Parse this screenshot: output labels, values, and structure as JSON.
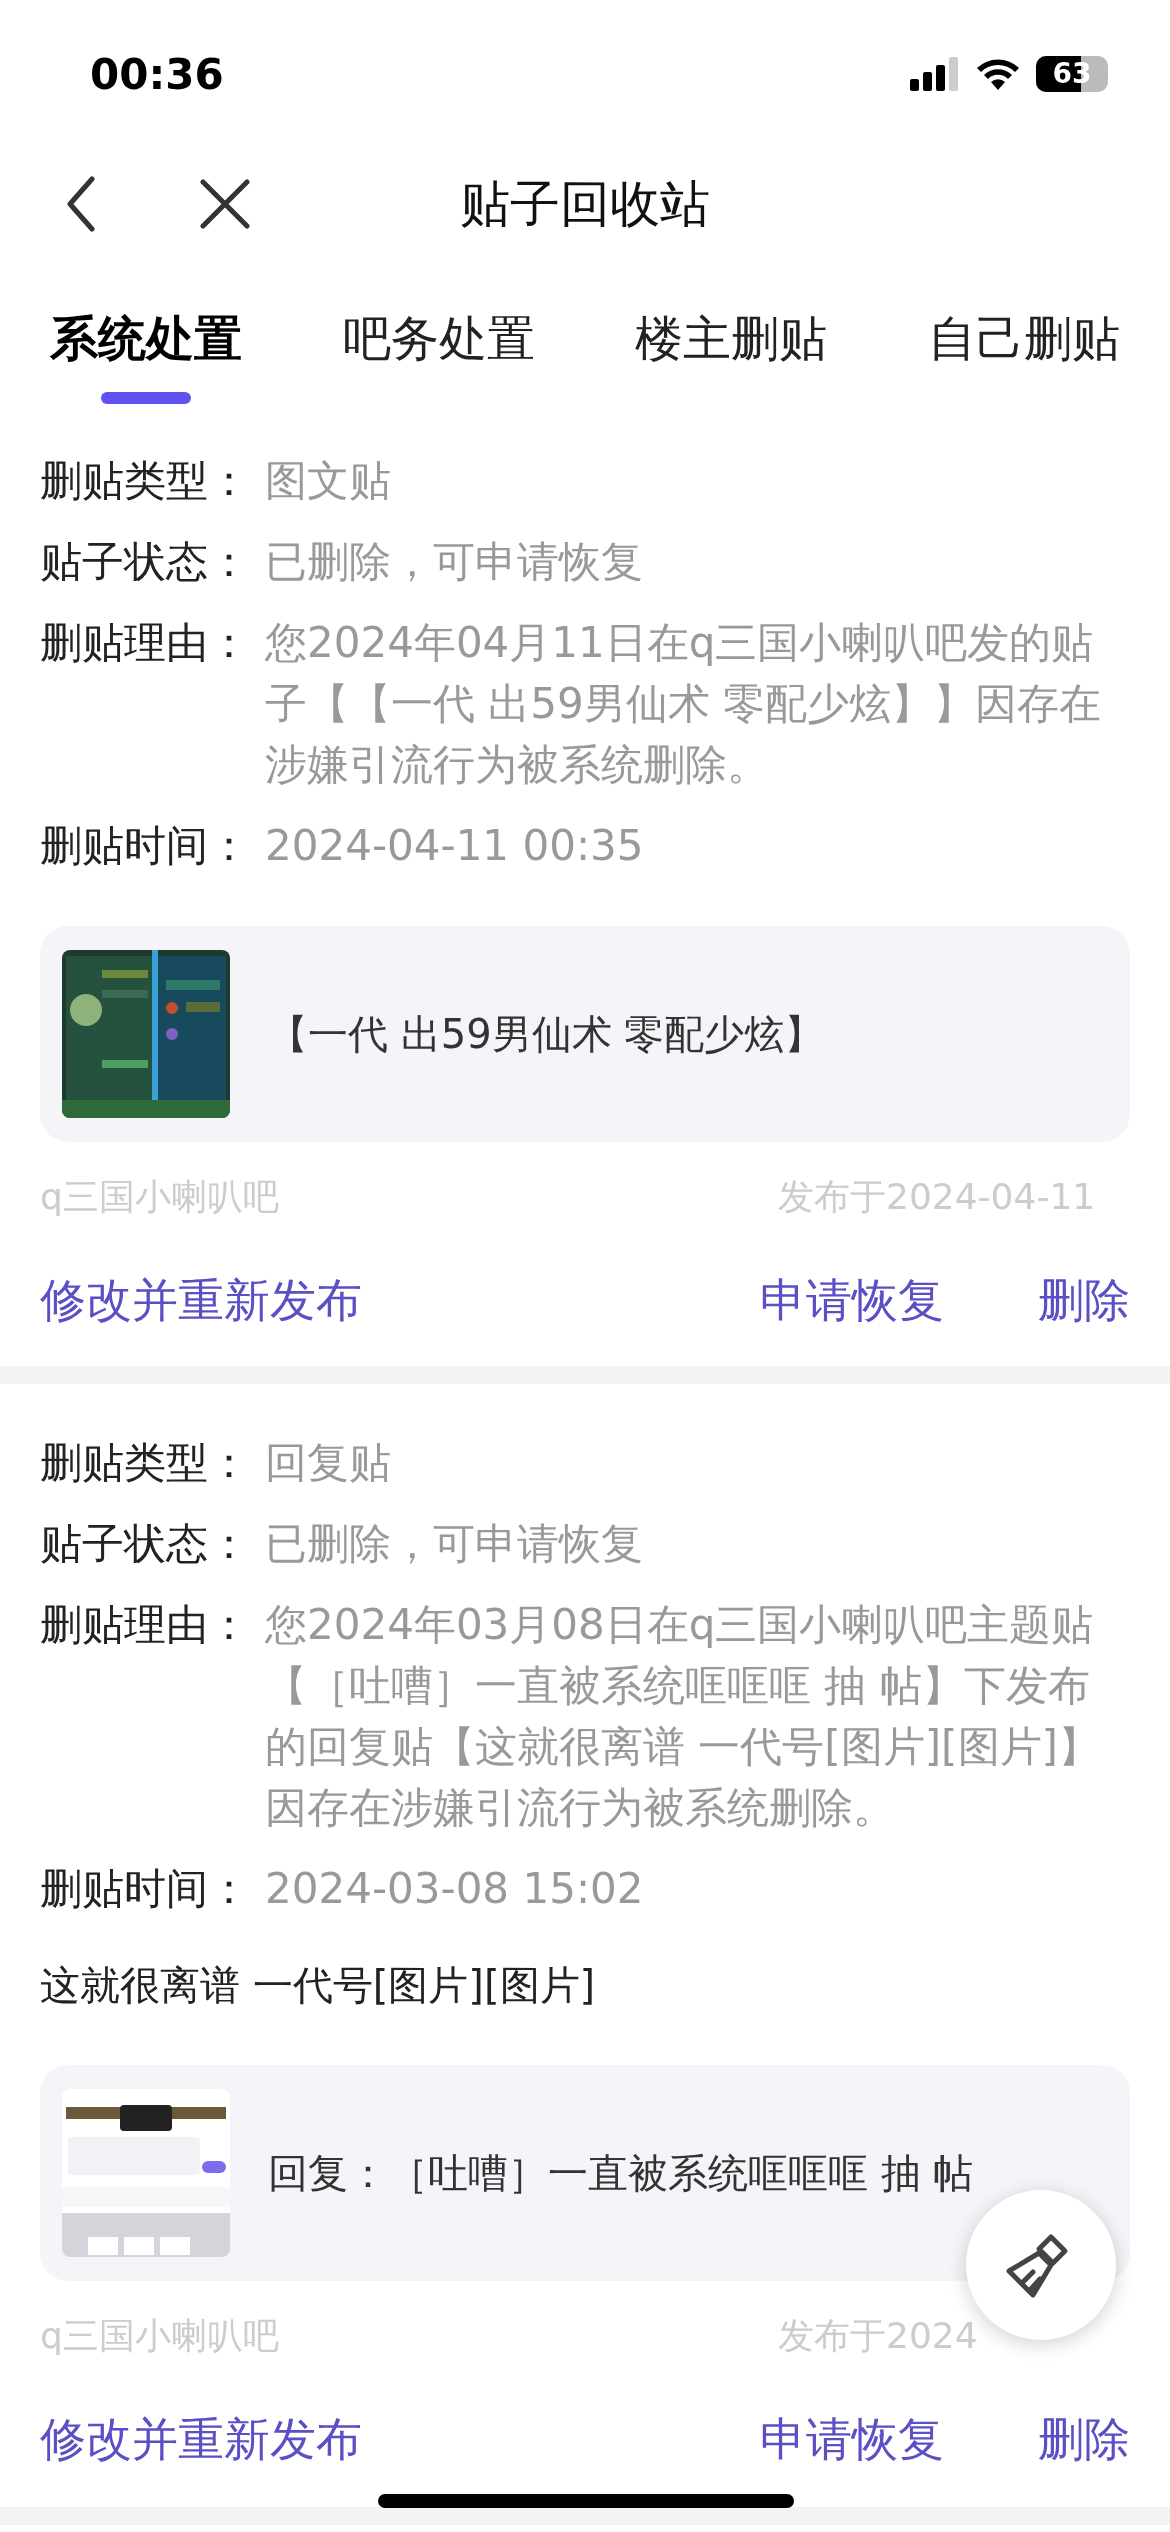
{
  "status_bar": {
    "time": "00:36",
    "battery": "63"
  },
  "nav": {
    "title": "贴子回收站"
  },
  "tabs": [
    {
      "label": "系统处置",
      "selected": true
    },
    {
      "label": "吧务处置",
      "selected": false
    },
    {
      "label": "楼主删贴",
      "selected": false
    },
    {
      "label": "自己删贴",
      "selected": false
    }
  ],
  "posts": [
    {
      "fields": [
        {
          "label": "删贴类型：",
          "value": "图文贴"
        },
        {
          "label": "贴子状态：",
          "value": "已删除，可申请恢复"
        },
        {
          "label": "删贴理由：",
          "value": "您2024年04月11日在q三国小喇叭吧发的贴子【【一代 出59男仙术 零配少炫】】因存在涉嫌引流行为被系统删除。"
        },
        {
          "label": "删贴时间：",
          "value": "2024-04-11 00:35"
        }
      ],
      "card": {
        "kind": "picture",
        "text": "【一代 出59男仙术 零配少炫】"
      },
      "forum": "q三国小喇叭吧",
      "date": "发布于2024-04-11",
      "actions": [
        "修改并重新发布",
        "申请恢复",
        "删除"
      ]
    },
    {
      "fields": [
        {
          "label": "删贴类型：",
          "value": "回复贴"
        },
        {
          "label": "贴子状态：",
          "value": "已删除，可申请恢复"
        },
        {
          "label": "删贴理由：",
          "value": "您2024年03月08日在q三国小喇叭吧主题贴【［吐嘈］一直被系统哐哐哐 抽 帖】下发布的回复贴【这就很离谱 一代号[图片][图片]】因存在涉嫌引流行为被系统删除。"
        },
        {
          "label": "删贴时间：",
          "value": "2024-03-08 15:02"
        }
      ],
      "content": "这就很离谱 一代号[图片][图片]",
      "card": {
        "kind": "picture",
        "text": "回复：［吐嘈］一直被系统哐哐哐 抽 帖"
      },
      "forum": "q三国小喇叭吧",
      "date": "发布于2024",
      "actions": [
        "修改并重新发布",
        "申请恢复",
        "删除"
      ]
    }
  ]
}
